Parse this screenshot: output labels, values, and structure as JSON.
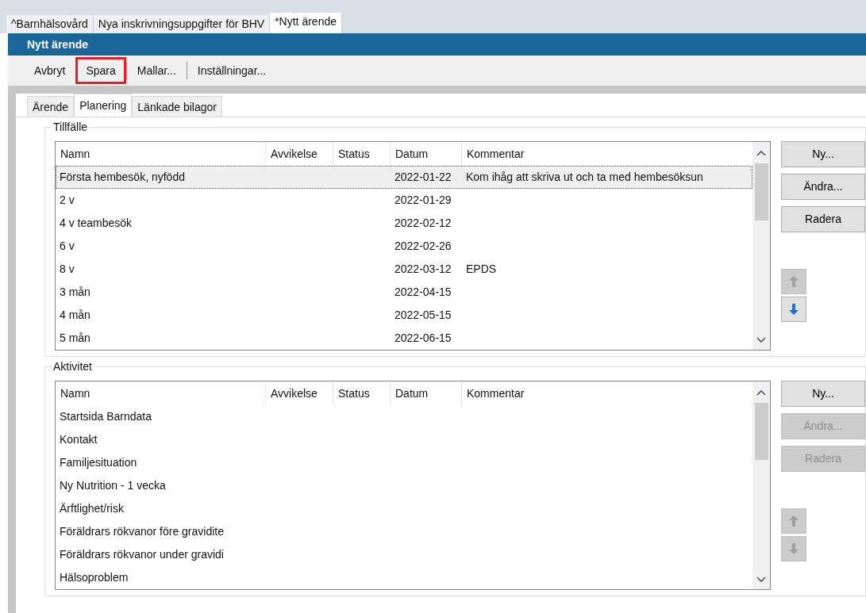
{
  "doc_tabs": [
    {
      "label": "^Barnhälsovård",
      "selected": false
    },
    {
      "label": "Nya inskrivningsuppgifter för BHV",
      "selected": false
    },
    {
      "label": "*Nytt ärende",
      "selected": true
    }
  ],
  "window": {
    "title": "Nytt ärende"
  },
  "toolbar": [
    {
      "label": "Avbryt",
      "highlighted": false
    },
    {
      "label": "Spara",
      "highlighted": true
    },
    {
      "label": "Mallar...",
      "highlighted": false
    },
    {
      "label": "Inställningar...",
      "highlighted": false
    }
  ],
  "tabs": [
    {
      "label": "Ärende",
      "selected": false
    },
    {
      "label": "Planering",
      "selected": true
    },
    {
      "label": "Länkade bilagor",
      "selected": false
    }
  ],
  "groups": [
    {
      "title": "Tillfälle",
      "columns": [
        "Namn",
        "Avvikelse",
        "Status",
        "Datum",
        "Kommentar"
      ],
      "rows": [
        {
          "cells": [
            "Första hembesök, nyfödd",
            "",
            "",
            "2022-01-22",
            "Kom ihåg att skriva ut och ta med hembesöksun"
          ],
          "selected": true
        },
        {
          "cells": [
            "2 v",
            "",
            "",
            "2022-01-29",
            ""
          ],
          "selected": false
        },
        {
          "cells": [
            "4 v teambesök",
            "",
            "",
            "2022-02-12",
            ""
          ],
          "selected": false
        },
        {
          "cells": [
            "6 v",
            "",
            "",
            "2022-02-26",
            ""
          ],
          "selected": false
        },
        {
          "cells": [
            "8 v",
            "",
            "",
            "2022-03-12",
            "EPDS"
          ],
          "selected": false
        },
        {
          "cells": [
            "3 mån",
            "",
            "",
            "2022-04-15",
            ""
          ],
          "selected": false
        },
        {
          "cells": [
            "4 mån",
            "",
            "",
            "2022-05-15",
            ""
          ],
          "selected": false
        },
        {
          "cells": [
            "5 mån",
            "",
            "",
            "2022-06-15",
            ""
          ],
          "selected": false
        }
      ],
      "buttons": [
        {
          "label": "Ny...",
          "disabled": false
        },
        {
          "label": "Ändra...",
          "disabled": false
        },
        {
          "label": "Radera",
          "disabled": false
        }
      ],
      "move_up": {
        "disabled": true
      },
      "move_down": {
        "disabled": false
      }
    },
    {
      "title": "Aktivitet",
      "columns": [
        "Namn",
        "Avvikelse",
        "Status",
        "Datum",
        "Kommentar"
      ],
      "rows": [
        {
          "cells": [
            "Startsida Barndata",
            "",
            "",
            "",
            ""
          ],
          "selected": false
        },
        {
          "cells": [
            "Kontakt",
            "",
            "",
            "",
            ""
          ],
          "selected": false
        },
        {
          "cells": [
            "Familjesituation",
            "",
            "",
            "",
            ""
          ],
          "selected": false
        },
        {
          "cells": [
            "Ny Nutrition - 1 vecka",
            "",
            "",
            "",
            ""
          ],
          "selected": false
        },
        {
          "cells": [
            "Ärftlighet/risk",
            "",
            "",
            "",
            ""
          ],
          "selected": false
        },
        {
          "cells": [
            "Föräldrars rökvanor före gravidite",
            "",
            "",
            "",
            ""
          ],
          "selected": false
        },
        {
          "cells": [
            "Föräldrars rökvanor under gravidi",
            "",
            "",
            "",
            ""
          ],
          "selected": false
        },
        {
          "cells": [
            "Hälsoproblem",
            "",
            "",
            "",
            ""
          ],
          "selected": false
        }
      ],
      "buttons": [
        {
          "label": "Ny...",
          "disabled": false
        },
        {
          "label": "Ändra...",
          "disabled": true
        },
        {
          "label": "Radera",
          "disabled": true
        }
      ],
      "move_up": {
        "disabled": true
      },
      "move_down": {
        "disabled": true
      }
    }
  ]
}
